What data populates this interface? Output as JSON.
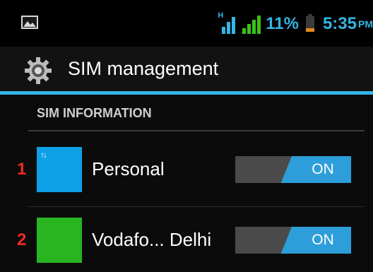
{
  "status_bar": {
    "battery_level": "11%",
    "time": "5:35",
    "ampm": "PM",
    "network_type": "H",
    "colors": {
      "accent": "#33b5e5",
      "battery": "#e08a1e"
    }
  },
  "action_bar": {
    "icon": "gear-icon",
    "title": "SIM management"
  },
  "section": {
    "header": "SIM INFORMATION"
  },
  "sims": [
    {
      "index": "1",
      "name": "Personal",
      "card_color": "#0ea0e6",
      "card_icon": "data-transfer-arrows-icon",
      "toggle_label": "ON",
      "enabled": true
    },
    {
      "index": "2",
      "name": "Vodafo... Delhi",
      "card_color": "#29b51f",
      "toggle_label": "ON",
      "enabled": true
    }
  ],
  "colors": {
    "divider_accent": "#33b5e5",
    "sim_index": "#ee2b24",
    "toggle_on": "#2d9ed9",
    "toggle_off": "#4a4a4a"
  }
}
